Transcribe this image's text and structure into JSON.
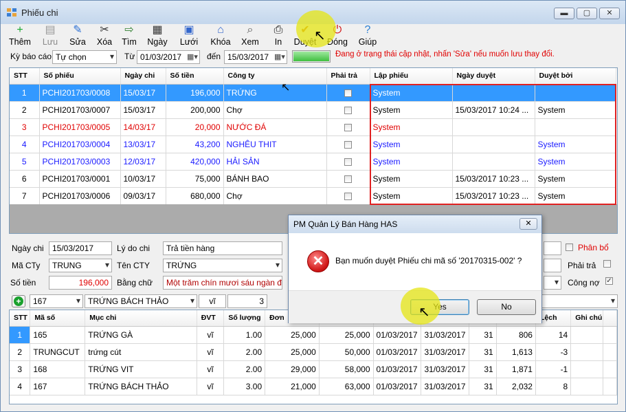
{
  "window": {
    "title": "Phiếu chi",
    "min": "▬",
    "max": "▢",
    "close": "✕"
  },
  "toolbar": [
    {
      "label": "Thêm",
      "icon": "add-icon",
      "glyph": "+",
      "color": "#17a82e"
    },
    {
      "label": "Lưu",
      "icon": "save-icon",
      "glyph": "▤",
      "color": "#999999"
    },
    {
      "label": "Sửa",
      "icon": "edit-icon",
      "glyph": "✎",
      "color": "#2a6fd4"
    },
    {
      "label": "Xóa",
      "icon": "delete-icon",
      "glyph": "✂",
      "color": "#333333"
    },
    {
      "label": "Tìm",
      "icon": "find-icon",
      "glyph": "⇨",
      "color": "#2f7f2f"
    },
    {
      "label": "Ngày",
      "icon": "calendar-icon",
      "glyph": "▦",
      "color": "#333333"
    },
    {
      "label": "Lưới",
      "icon": "grid-icon",
      "glyph": "▣",
      "color": "#3366cc"
    },
    {
      "label": "Khóa",
      "icon": "lock-icon",
      "glyph": "⌂",
      "color": "#3366cc"
    },
    {
      "label": "Xem",
      "icon": "preview-icon",
      "glyph": "⌕",
      "color": "#555555"
    },
    {
      "label": "In",
      "icon": "print-icon",
      "glyph": "⎙",
      "color": "#111111"
    },
    {
      "label": "Duyệt",
      "icon": "approve-icon",
      "glyph": "✔",
      "color": "#cc7a00"
    },
    {
      "label": "Đóng",
      "icon": "power-icon",
      "glyph": "⏻",
      "color": "#d01010"
    },
    {
      "label": "Giúp",
      "icon": "help-book-icon",
      "glyph": "?",
      "color": "#2a7fd4"
    }
  ],
  "filter": {
    "period_label": "Kỳ báo cáo",
    "period_value": "Tự chọn",
    "from_label": "Từ",
    "from_value": "01/03/2017",
    "to_label": "đến",
    "to_value": "15/03/2017",
    "progress": 1.0,
    "status_msg": "Đang ở trạng thái cập nhật, nhấn 'Sửa' nếu muốn lưu thay đổi."
  },
  "vouchers": {
    "columns": [
      "STT",
      "Số phiếu",
      "Ngày chi",
      "Số tiền",
      "Công ty",
      "Phải trả",
      "Lập phiếu",
      "Ngày duyệt",
      "Duyệt bởi"
    ],
    "rows": [
      {
        "stt": "1",
        "so_phieu": "PCHI201703/0008",
        "ngay_chi": "15/03/17",
        "so_tien": "196,000",
        "cong_ty": "TRỨNG",
        "phai_tra": false,
        "lap_phieu": "System",
        "ngay_duyet": "",
        "duyet_boi": "",
        "style": "sel"
      },
      {
        "stt": "2",
        "so_phieu": "PCHI201703/0007",
        "ngay_chi": "15/03/17",
        "so_tien": "200,000",
        "cong_ty": "Chợ",
        "phai_tra": false,
        "lap_phieu": "System",
        "ngay_duyet": "15/03/2017 10:24 ...",
        "duyet_boi": "System",
        "style": ""
      },
      {
        "stt": "3",
        "so_phieu": "PCHI201703/0005",
        "ngay_chi": "14/03/17",
        "so_tien": "20,000",
        "cong_ty": "NƯỚC ĐÁ",
        "phai_tra": false,
        "lap_phieu": "System",
        "ngay_duyet": "",
        "duyet_boi": "",
        "style": "red"
      },
      {
        "stt": "4",
        "so_phieu": "PCHI201703/0004",
        "ngay_chi": "13/03/17",
        "so_tien": "43,200",
        "cong_ty": "NGHÊU THIT",
        "phai_tra": false,
        "lap_phieu": "System",
        "ngay_duyet": "",
        "duyet_boi": "System",
        "style": "blue"
      },
      {
        "stt": "5",
        "so_phieu": "PCHI201703/0003",
        "ngay_chi": "12/03/17",
        "so_tien": "420,000",
        "cong_ty": "HẢI SẢN",
        "phai_tra": false,
        "lap_phieu": "System",
        "ngay_duyet": "",
        "duyet_boi": "System",
        "style": "blue"
      },
      {
        "stt": "6",
        "so_phieu": "PCHI201703/0001",
        "ngay_chi": "10/03/17",
        "so_tien": "75,000",
        "cong_ty": "BÁNH BAO",
        "phai_tra": false,
        "lap_phieu": "System",
        "ngay_duyet": "15/03/2017 10:23 ...",
        "duyet_boi": "System",
        "style": ""
      },
      {
        "stt": "7",
        "so_phieu": "PCHI201703/0006",
        "ngay_chi": "09/03/17",
        "so_tien": "680,000",
        "cong_ty": "Chợ",
        "phai_tra": false,
        "lap_phieu": "System",
        "ngay_duyet": "15/03/2017 10:23 ...",
        "duyet_boi": "System",
        "style": ""
      }
    ]
  },
  "form": {
    "ngay_chi_label": "Ngày chi",
    "ngay_chi": "15/03/2017",
    "ly_do_label": "Lý do chi",
    "ly_do": "Trả tiền hàng",
    "ma_cty_label": "Mã CTy",
    "ma_cty": "TRUNG",
    "ten_cty_label": "Tên CTY",
    "ten_cty": "TRỨNG",
    "so_tien_label": "Số tiền",
    "so_tien": "196,000",
    "bang_chu_label": "Bằng chữ",
    "bang_chu": "Một trăm chín mươi sáu ngàn đ",
    "phan_bo_label": "Phân bổ",
    "phai_tra_label": "Phải trả",
    "cong_no_label": "Công nợ",
    "phan_bo": false,
    "phai_tra": false,
    "cong_no": true
  },
  "item_entry": {
    "code": "167",
    "name": "TRỨNG BÁCH THẢO",
    "unit": "vĩ",
    "qty": "3"
  },
  "details": {
    "columns": [
      "STT",
      "Mã số",
      "Mục chi",
      "ĐVT",
      "Số lượng",
      "Đơn",
      "",
      "",
      "",
      "",
      "",
      "Lệch",
      "Ghi chú"
    ],
    "rows": [
      {
        "stt": "1",
        "ma": "165",
        "muc": "TRỨNG GÀ",
        "dvt": "vĩ",
        "sl": "1.00",
        "don": "25,000",
        "tt": "25,000",
        "d1": "01/03/2017",
        "d2": "31/03/2017",
        "n": "31",
        "v": "806",
        "lech": "14",
        "sel": true
      },
      {
        "stt": "2",
        "ma": "TRUNGCUT",
        "muc": "trứng cút",
        "dvt": "vĩ",
        "sl": "2.00",
        "don": "25,000",
        "tt": "50,000",
        "d1": "01/03/2017",
        "d2": "31/03/2017",
        "n": "31",
        "v": "1,613",
        "lech": "-3",
        "sel": false
      },
      {
        "stt": "3",
        "ma": "168",
        "muc": "TRỨNG VIT",
        "dvt": "vĩ",
        "sl": "2.00",
        "don": "29,000",
        "tt": "58,000",
        "d1": "01/03/2017",
        "d2": "31/03/2017",
        "n": "31",
        "v": "1,871",
        "lech": "-1",
        "sel": false
      },
      {
        "stt": "4",
        "ma": "167",
        "muc": "TRỨNG BÁCH THẢO",
        "dvt": "vĩ",
        "sl": "3.00",
        "don": "21,000",
        "tt": "63,000",
        "d1": "01/03/2017",
        "d2": "31/03/2017",
        "n": "31",
        "v": "2,032",
        "lech": "8",
        "sel": false
      }
    ]
  },
  "dialog": {
    "title": "PM Quản Lý Bán Hàng HAS",
    "message": "Bạn muốn duyệt Phiếu chi mã số '20170315-002' ?",
    "yes": "Yes",
    "no": "No",
    "close": "✕"
  }
}
